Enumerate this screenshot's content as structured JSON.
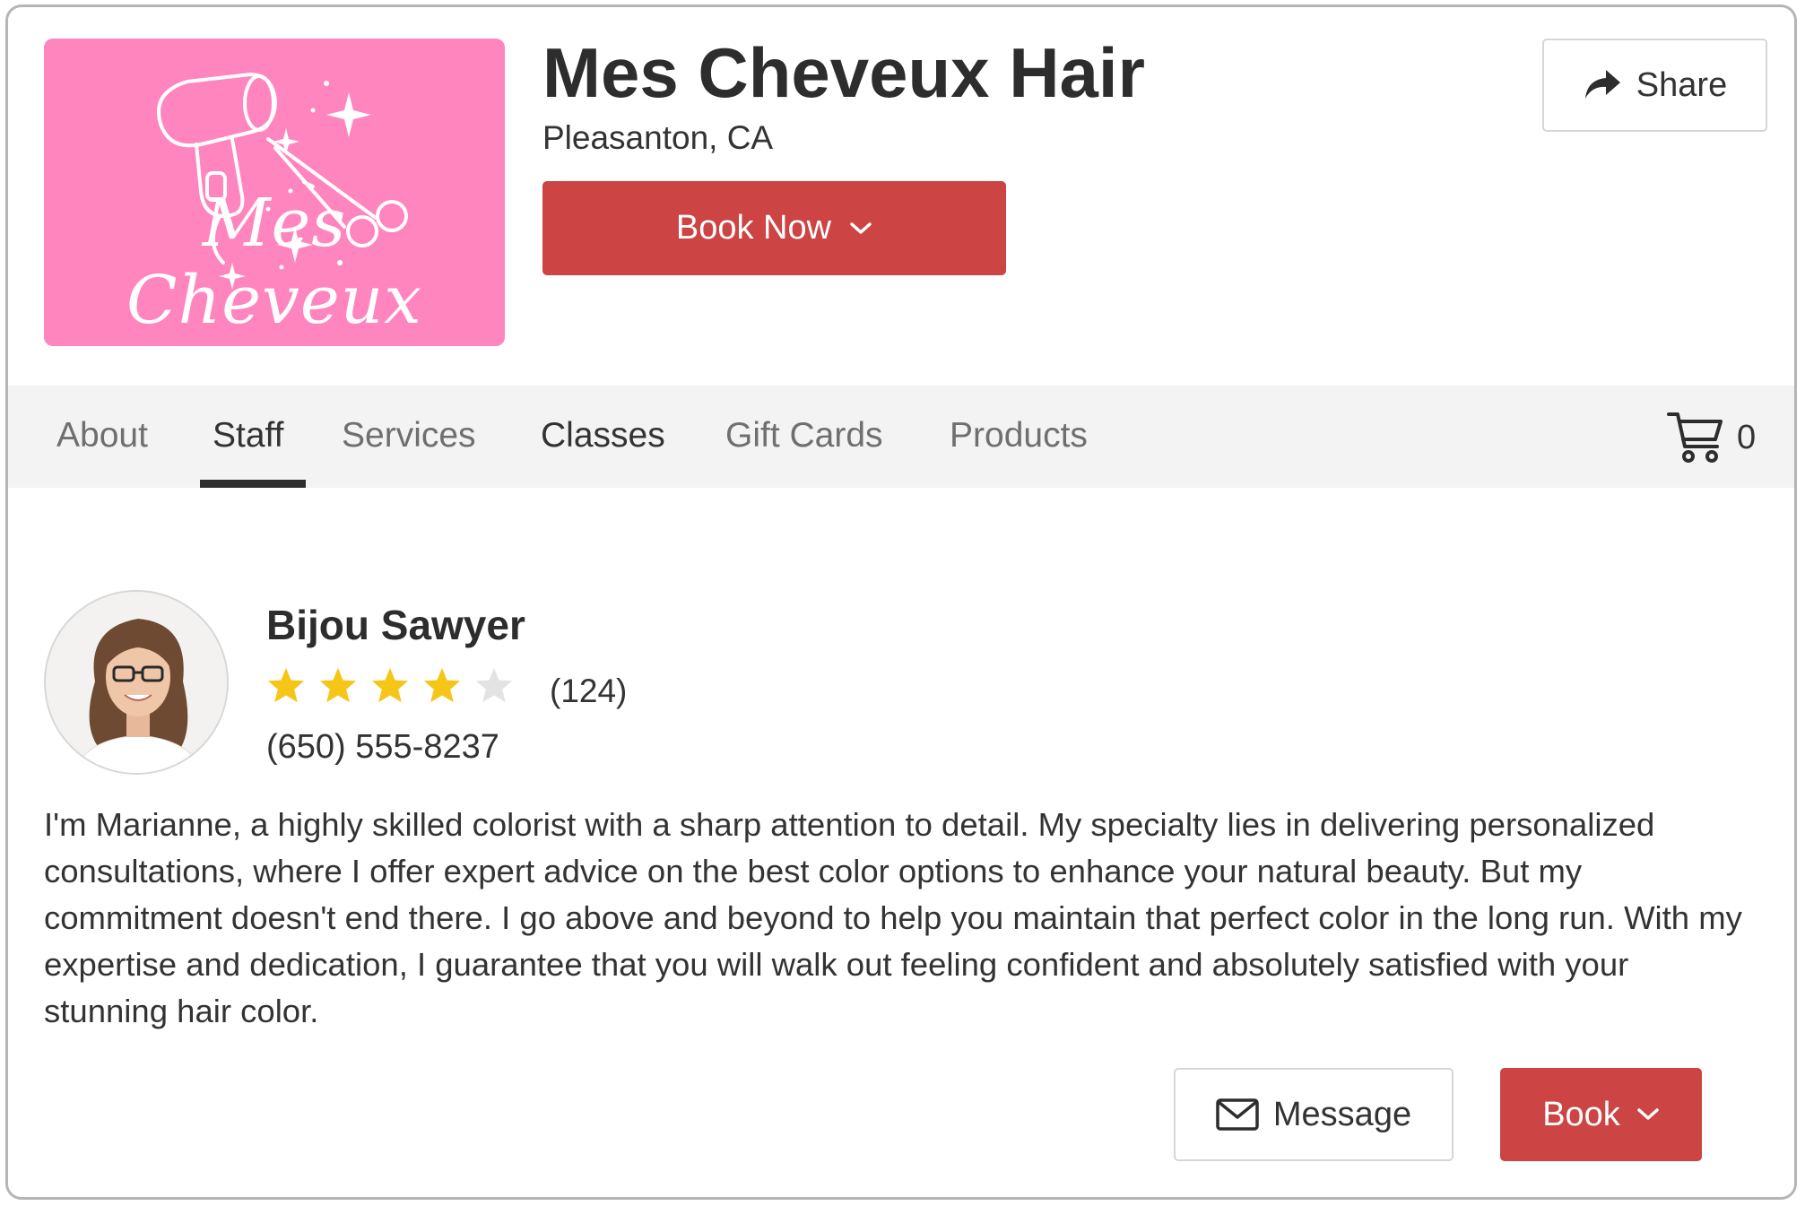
{
  "business": {
    "name": "Mes Cheveux Hair",
    "location": "Pleasanton, CA",
    "logo_text": "Mes Cheveux",
    "logo_bg": "#ff85bf"
  },
  "actions": {
    "book_now_label": "Book Now",
    "share_label": "Share"
  },
  "nav": {
    "tabs": [
      {
        "label": "About",
        "active": false
      },
      {
        "label": "Staff",
        "active": true
      },
      {
        "label": "Services",
        "active": false
      },
      {
        "label": "Classes",
        "active": false
      },
      {
        "label": "Gift Cards",
        "active": false
      },
      {
        "label": "Products",
        "active": false
      }
    ],
    "cart_count": "0"
  },
  "staff": {
    "name": "Bijou Sawyer",
    "rating_stars": 4,
    "rating_max": 5,
    "review_count": "(124)",
    "phone": "(650) 555-8237",
    "bio": "I'm Marianne, a highly skilled colorist with a sharp attention to detail. My specialty lies in delivering personalized consultations, where I offer expert advice on the best color options to enhance your natural beauty. But my commitment doesn't end there. I go above and beyond to help you maintain that perfect color in the long run. With my expertise and dedication, I guarantee that you will walk out feeling confident and absolutely satisfied with your stunning hair color.",
    "message_label": "Message",
    "book_label": "Book"
  },
  "colors": {
    "primary_red": "#cc4443",
    "star_filled": "#f5c518",
    "star_empty": "#e3e3e3"
  },
  "icons": {
    "share": "share-arrow-icon",
    "chevron": "chevron-down-icon",
    "cart": "cart-icon",
    "message": "envelope-icon",
    "star": "star-icon"
  }
}
